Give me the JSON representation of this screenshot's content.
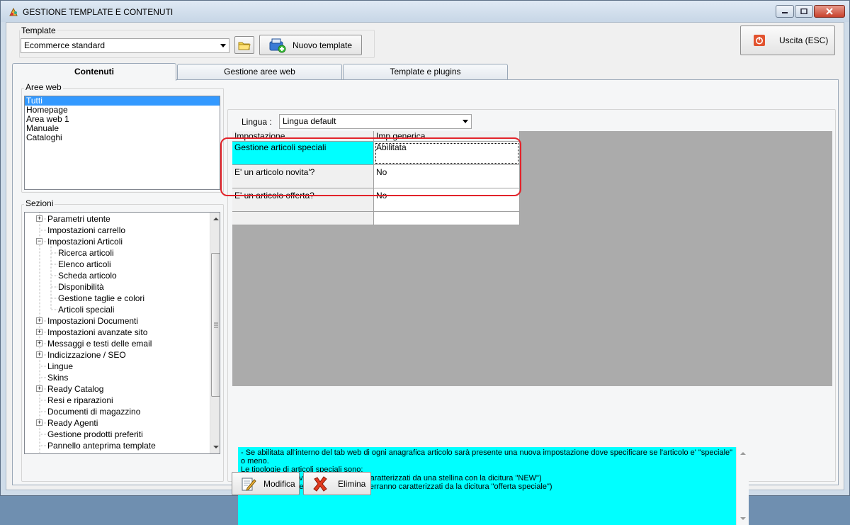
{
  "window": {
    "title": "GESTIONE TEMPLATE E CONTENUTI"
  },
  "template": {
    "label": "Template",
    "selected": "Ecommerce standard",
    "new_button": "Nuovo template"
  },
  "exit_button": "Uscita (ESC)",
  "tabs": [
    {
      "label": "Contenuti"
    },
    {
      "label": "Gestione aree web"
    },
    {
      "label": "Template e plugins"
    }
  ],
  "aree_web": {
    "label": "Aree web",
    "items": [
      "Tutti",
      "Homepage",
      "Area web 1",
      "Manuale",
      "Cataloghi"
    ],
    "selected": "Tutti"
  },
  "sezioni": {
    "label": "Sezioni",
    "items": [
      {
        "label": "Parametri utente",
        "expander": "+",
        "level": 0
      },
      {
        "label": "Impostazioni carrello",
        "expander": "",
        "level": 0
      },
      {
        "label": "Impostazioni Articoli",
        "expander": "-",
        "level": 0
      },
      {
        "label": "Ricerca articoli",
        "expander": "",
        "level": 1
      },
      {
        "label": "Elenco articoli",
        "expander": "",
        "level": 1
      },
      {
        "label": "Scheda articolo",
        "expander": "",
        "level": 1
      },
      {
        "label": "Disponibilità",
        "expander": "",
        "level": 1
      },
      {
        "label": "Gestione taglie e colori",
        "expander": "",
        "level": 1
      },
      {
        "label": "Articoli speciali",
        "expander": "",
        "level": 1
      },
      {
        "label": "Impostazioni Documenti",
        "expander": "+",
        "level": 0
      },
      {
        "label": "Impostazioni avanzate sito",
        "expander": "+",
        "level": 0
      },
      {
        "label": "Messaggi e testi delle email",
        "expander": "+",
        "level": 0
      },
      {
        "label": "Indicizzazione / SEO",
        "expander": "+",
        "level": 0
      },
      {
        "label": "Lingue",
        "expander": "",
        "level": 0
      },
      {
        "label": "Skins",
        "expander": "",
        "level": 0
      },
      {
        "label": "Ready Catalog",
        "expander": "+",
        "level": 0
      },
      {
        "label": "Resi e riparazioni",
        "expander": "",
        "level": 0
      },
      {
        "label": "Documenti di magazzino",
        "expander": "",
        "level": 0
      },
      {
        "label": "Ready Agenti",
        "expander": "+",
        "level": 0
      },
      {
        "label": "Gestione prodotti preferiti",
        "expander": "",
        "level": 0
      },
      {
        "label": "Pannello anteprima template",
        "expander": "",
        "level": 0
      }
    ]
  },
  "lingua": {
    "label": "Lingua :",
    "selected": "Lingua default"
  },
  "grid": {
    "headers": [
      "Impostazione",
      "Imp.generica"
    ],
    "rows": [
      {
        "name": "Gestione articoli speciali",
        "value": "Abilitata"
      },
      {
        "name": "E' un articolo novita'?",
        "value": "No"
      },
      {
        "name": "E' un articolo offerta?",
        "value": "No"
      }
    ]
  },
  "description": {
    "lines": [
      "- Se abilitata all'interno del tab web di ogni anagrafica articolo sarà presente una nuova impostazione dove specificare se l'articolo e' \"speciale\" o meno.",
      "Le tipologie di articoli speciali sono:",
      "1) Gli articoli \"Novità\" (che verranno caratterizzati da una stellina con la dicitura \"NEW\")",
      "2) Gli articoli \"Offerta speciale\" (che verranno caratterizzati da la dicitura \"offerta speciale\")"
    ]
  },
  "buttons": {
    "modifica": "Modifica",
    "elimina": "Elimina"
  },
  "colors": {
    "highlight": "#00ffff",
    "selection": "#3399ff",
    "annotation": "#e2232a"
  }
}
